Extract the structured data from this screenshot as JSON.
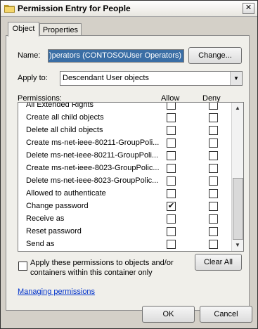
{
  "window": {
    "title": "Permission Entry for People",
    "close_glyph": "✕"
  },
  "tabs": [
    "Object",
    "Properties"
  ],
  "name_row": {
    "label": "Name:",
    "value": ")perators (CONTOSO\\User Operators)",
    "change_button": "Change..."
  },
  "apply_row": {
    "label": "Apply to:",
    "value": "Descendant User objects"
  },
  "permissions": {
    "header": "Permissions:",
    "allow_header": "Allow",
    "deny_header": "Deny",
    "rows": [
      {
        "label": "All Extended Rights",
        "allow": false,
        "deny": false
      },
      {
        "label": "Create all child objects",
        "allow": false,
        "deny": false
      },
      {
        "label": "Delete all child objects",
        "allow": false,
        "deny": false
      },
      {
        "label": "Create ms-net-ieee-80211-GroupPoli...",
        "allow": false,
        "deny": false
      },
      {
        "label": "Delete ms-net-ieee-80211-GroupPoli...",
        "allow": false,
        "deny": false
      },
      {
        "label": "Create ms-net-ieee-8023-GroupPolic...",
        "allow": false,
        "deny": false
      },
      {
        "label": "Delete ms-net-ieee-8023-GroupPolic...",
        "allow": false,
        "deny": false
      },
      {
        "label": "Allowed to authenticate",
        "allow": false,
        "deny": false
      },
      {
        "label": "Change password",
        "allow": true,
        "deny": false
      },
      {
        "label": "Receive as",
        "allow": false,
        "deny": false
      },
      {
        "label": "Reset password",
        "allow": false,
        "deny": false
      },
      {
        "label": "Send as",
        "allow": false,
        "deny": false
      }
    ]
  },
  "apply_inherit": {
    "text_line1": "Apply these permissions to objects and/or",
    "text_line2": "containers within this container only",
    "checked": false
  },
  "clear_all_button": "Clear All",
  "help_link": "Managing permissions",
  "ok_button": "OK",
  "cancel_button": "Cancel",
  "check_glyph": "✔"
}
